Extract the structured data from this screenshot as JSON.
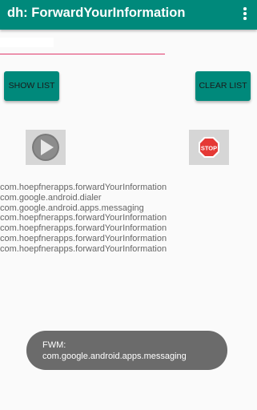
{
  "appbar": {
    "title": "dh: ForwardYourInformation",
    "color": "#00897b",
    "menu_icon": "overflow-menu-icon"
  },
  "input": {
    "value": "",
    "underline_color": "#e0386b"
  },
  "buttons": {
    "show_list": "SHOW LIST",
    "clear_list": "CLEAR LIST"
  },
  "controls": {
    "play_icon": "play-icon",
    "stop_icon": "stop-icon",
    "stop_label": "STOP"
  },
  "list": {
    "items": [
      "com.hoepfnerapps.forwardYourInformation",
      "com.google.android.dialer",
      "com.google.android.apps.messaging",
      "com.hoepfnerapps.forwardYourInformation",
      "com.hoepfnerapps.forwardYourInformation",
      "com.hoepfnerapps.forwardYourInformation",
      "com.hoepfnerapps.forwardYourInformation"
    ]
  },
  "toast": {
    "line1": "FWM:",
    "line2": "com.google.android.apps.messaging"
  }
}
